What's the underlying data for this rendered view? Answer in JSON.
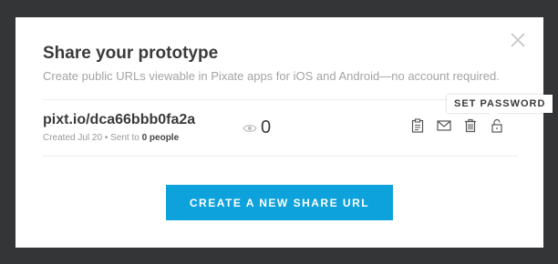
{
  "dialog": {
    "title": "Share your prototype",
    "subtitle": "Create public URLs viewable in Pixate apps for iOS and Android—no account required.",
    "close_icon": "close-icon"
  },
  "share": {
    "url": "pixt.io/dca66bbb0fa2a",
    "created_text": "Created Jul 20 • Sent to ",
    "sent_count": "0 people",
    "views_icon": "eye-icon",
    "views": "0",
    "actions": [
      {
        "name": "copy-button",
        "icon": "clipboard-icon"
      },
      {
        "name": "email-button",
        "icon": "envelope-icon"
      },
      {
        "name": "delete-button",
        "icon": "trash-icon"
      },
      {
        "name": "set-password-button",
        "icon": "unlock-icon"
      }
    ],
    "tooltip": "SET PASSWORD"
  },
  "cta_label": "CREATE A NEW SHARE URL",
  "colors": {
    "backdrop": "#333536",
    "accent": "#0ea2dc",
    "text": "#3a3a3a",
    "muted": "#a3a3a3"
  }
}
